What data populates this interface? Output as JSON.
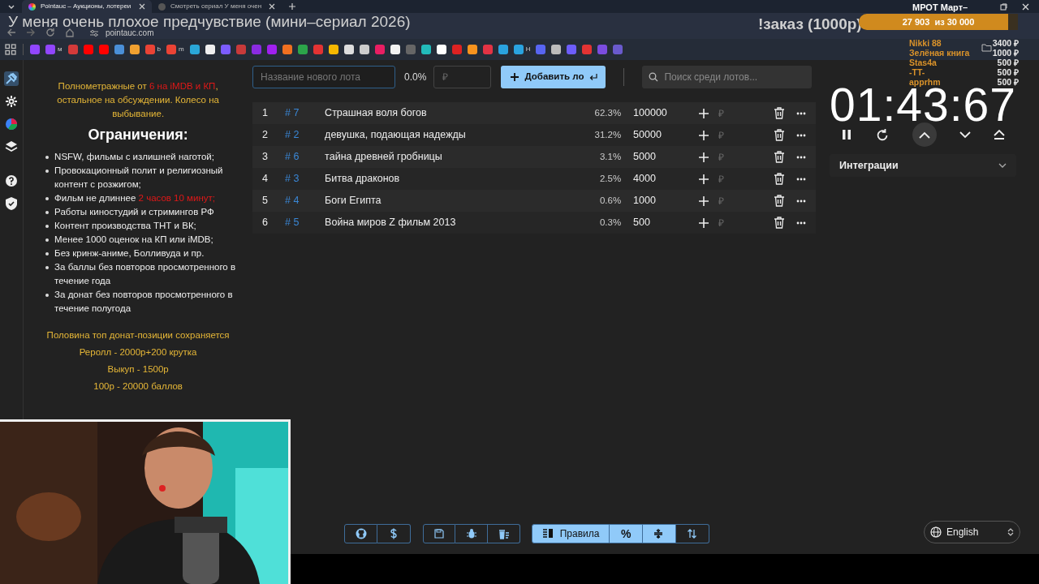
{
  "browser": {
    "tabs": [
      {
        "title": "Pointauc – Аукционы, лотереи",
        "selected": true
      },
      {
        "title": "Смотреть сериал У меня очен",
        "selected": false
      }
    ],
    "address": "pointauc.com",
    "bookmarks": [
      {
        "color": "#9146ff"
      },
      {
        "color": "#9146ff",
        "label": "м"
      },
      {
        "color": "#d33a3a"
      },
      {
        "color": "#ff0000"
      },
      {
        "color": "#ff0000"
      },
      {
        "color": "#4a8fd8"
      },
      {
        "color": "#f0a030"
      },
      {
        "color": "#ea4335",
        "label": "b"
      },
      {
        "color": "#ea4335",
        "label": "m"
      },
      {
        "color": "#2aa7d8"
      },
      {
        "color": "#eeeeee"
      },
      {
        "color": "#7b5cff"
      },
      {
        "color": "#c83a3a"
      },
      {
        "color": "#8a2be2"
      },
      {
        "color": "#a020f0"
      },
      {
        "color": "#f07020"
      },
      {
        "color": "#2ca44a"
      },
      {
        "color": "#e33333"
      },
      {
        "color": "#f5b800"
      },
      {
        "color": "#dddddd"
      },
      {
        "color": "#cccccc"
      },
      {
        "color": "#e91e63"
      },
      {
        "color": "#f2f2f2"
      },
      {
        "color": "#666666"
      },
      {
        "color": "#22bbbb"
      },
      {
        "color": "#ffffff"
      },
      {
        "color": "#dd2222"
      },
      {
        "color": "#f7931e"
      },
      {
        "color": "#e33344"
      },
      {
        "color": "#2aa3e0"
      },
      {
        "color": "#2aa3e0",
        "label": "Н"
      },
      {
        "color": "#5865f2"
      },
      {
        "color": "#bbbbbb"
      },
      {
        "color": "#6d5dfc"
      },
      {
        "color": "#e33333"
      },
      {
        "color": "#7b4ce0"
      },
      {
        "color": "#6a5acd"
      }
    ]
  },
  "overlay": {
    "stream_title": "У меня очень плохое предчувствие (мини–сериал 2026)",
    "order": "!заказ (1000р)",
    "goal": {
      "label": "27 903  из 30 000",
      "level": 0.94
    },
    "corner_label": "МРОТ Март–",
    "donations": [
      {
        "name": "Nikki 88",
        "amount": "3400 ₽"
      },
      {
        "name": "Зелёная книга",
        "amount": "1000 ₽"
      },
      {
        "name": "Stas4a",
        "amount": "500 ₽"
      },
      {
        "name": "-TT-",
        "amount": "500 ₽"
      },
      {
        "name": "apprhm",
        "amount": "500 ₽"
      }
    ]
  },
  "sidebar": {
    "items": [
      {
        "selected": true
      },
      {
        "selected": false
      },
      {
        "selected": false
      },
      {
        "selected": false
      },
      {
        "selected": false
      },
      {
        "selected": false
      }
    ]
  },
  "rules": {
    "intro": [
      {
        "text": "Полнометражные от ",
        "highlight": false
      },
      {
        "text": "6 на iMDB и КП",
        "highlight": true
      },
      {
        "text": ", остальное на обсуждении. Колесо на выбывание.",
        "highlight": false
      }
    ],
    "heading": "Ограничения:",
    "items": [
      [
        {
          "text": "NSFW, фильмы с излишней наготой;",
          "highlight": false
        }
      ],
      [
        {
          "text": "Провокационный полит и религиозный контент с розжигом;",
          "highlight": false
        }
      ],
      [
        {
          "text": "Фильм не длиннее ",
          "highlight": false
        },
        {
          "text": "2 часов 10 минут;",
          "highlight": true
        }
      ],
      [
        {
          "text": "Работы киностудий и стримингов РФ",
          "highlight": false
        }
      ],
      [
        {
          "text": "Контент производства ТНТ и ВК;",
          "highlight": false
        }
      ],
      [
        {
          "text": "Менее 1000 оценок на КП или iMDB;",
          "highlight": false
        }
      ],
      [
        {
          "text": "Без кринж-аниме, Болливуда и пр.",
          "highlight": false
        }
      ],
      [
        {
          "text": "За баллы без повторов просмотренного в течение года",
          "highlight": false
        }
      ],
      [
        {
          "text": "За донат без повторов просмотренного в течение полугода",
          "highlight": false
        }
      ]
    ],
    "footer": [
      "Половина топ донат-позиции сохраняется",
      "Реролл - 2000р+200 крутка",
      "Выкуп - 1500р",
      "100р - 20000 баллов"
    ]
  },
  "new_lot": {
    "name_placeholder": "Название нового лота",
    "percent": "0.0%",
    "amount_placeholder": "₽",
    "add_button": "Добавить ло"
  },
  "search": {
    "placeholder": "Поиск среди лотов..."
  },
  "lots": [
    {
      "index": "1",
      "id": "# 7",
      "name": "Страшная воля богов",
      "percent": "62.3%",
      "amount": "100000",
      "add_placeholder": "₽"
    },
    {
      "index": "2",
      "id": "# 2",
      "name": "девушка, подающая надежды",
      "percent": "31.2%",
      "amount": "50000",
      "add_placeholder": "₽"
    },
    {
      "index": "3",
      "id": "# 6",
      "name": "тайна древней гробницы",
      "percent": "3.1%",
      "amount": "5000",
      "add_placeholder": "₽"
    },
    {
      "index": "4",
      "id": "# 3",
      "name": "Битва драконов",
      "percent": "2.5%",
      "amount": "4000",
      "add_placeholder": "₽"
    },
    {
      "index": "5",
      "id": "# 4",
      "name": "Боги Египта",
      "percent": "0.6%",
      "amount": "1000",
      "add_placeholder": "₽"
    },
    {
      "index": "6",
      "id": "# 5",
      "name": "Война миров Z фильм 2013",
      "percent": "0.3%",
      "amount": "500",
      "add_placeholder": "₽"
    }
  ],
  "timer": {
    "time": "01:43:67"
  },
  "integrations": {
    "label": "Интеграции",
    "expanded": false
  },
  "toolbar": {
    "toggles": [
      {
        "kind": "rules",
        "label": "Правила",
        "on": true
      },
      {
        "kind": "percent",
        "label": "%",
        "on": true
      },
      {
        "kind": "split",
        "on": true
      },
      {
        "kind": "sort",
        "on": false
      }
    ]
  },
  "language": {
    "value": "English"
  }
}
